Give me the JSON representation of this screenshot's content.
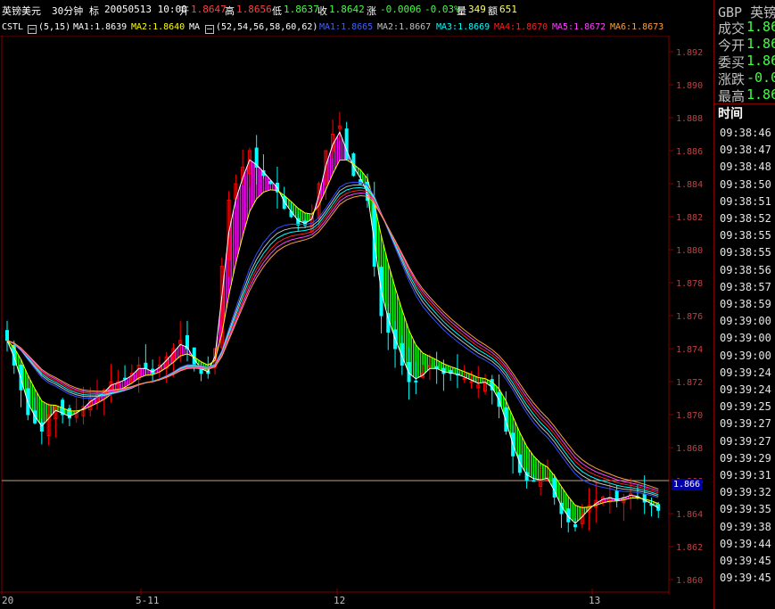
{
  "header": {
    "symbol": "英镑美元",
    "period": "30分钟",
    "marker": "标",
    "datetime": "20050513 10:00",
    "open_label": "开",
    "open": "1.8647",
    "high_label": "高",
    "high": "1.8656",
    "low_label": "低",
    "low": "1.8637",
    "close_label": "收",
    "close": "1.8642",
    "change_label": "涨",
    "change": "-0.0006",
    "change_pct": "-0.03%",
    "volume_label": "量",
    "volume": "349",
    "amount_label": "额",
    "amount": "651"
  },
  "indicators": {
    "cstl": "CSTL",
    "cstl_params": "(5,15)",
    "ma1": "MA1:1.8639",
    "ma2": "MA2:1.8640",
    "ma": "MA",
    "ma_params": "(52,54,56,58,60,62)",
    "m1": "MA1:1.8665",
    "m2": "MA2:1.8667",
    "m3": "MA3:1.8669",
    "m4": "MA4:1.8670",
    "m5": "MA5:1.8672",
    "m6": "MA6:1.8673"
  },
  "axis": {
    "y_ticks": [
      "1.892",
      "1.890",
      "1.888",
      "1.886",
      "1.884",
      "1.882",
      "1.880",
      "1.878",
      "1.876",
      "1.874",
      "1.872",
      "1.870",
      "1.868",
      "1.866",
      "1.864",
      "1.862",
      "1.860"
    ],
    "x_ticks": [
      "20",
      "5-11",
      "12",
      "13"
    ],
    "current_price": "1.866"
  },
  "right_panel": {
    "title": "GBP 英镑",
    "rows": [
      {
        "label": "成交",
        "value": "1.86"
      },
      {
        "label": "今开",
        "value": "1.86"
      },
      {
        "label": "委买",
        "value": "1.86"
      },
      {
        "label": "涨跌",
        "value": "-0.0"
      },
      {
        "label": "最高",
        "value": "1.86"
      }
    ],
    "time_header": "时间",
    "times": [
      "09:38:46",
      "09:38:47",
      "09:38:48",
      "09:38:50",
      "09:38:51",
      "09:38:52",
      "09:38:55",
      "09:38:55",
      "09:38:56",
      "09:38:57",
      "09:38:59",
      "09:39:00",
      "09:39:00",
      "09:39:00",
      "09:39:24",
      "09:39:24",
      "09:39:25",
      "09:39:27",
      "09:39:27",
      "09:39:29",
      "09:39:31",
      "09:39:32",
      "09:39:35",
      "09:39:38",
      "09:39:44",
      "09:39:45",
      "09:39:45"
    ]
  },
  "colors": {
    "up": "#ff0000",
    "down": "#00ffff",
    "fill_up": "#ff00ff",
    "fill_down": "#00ff00",
    "ma_blue": "#3050ff",
    "ma_yellow": "#ffff00",
    "ma_orange": "#ff8000"
  },
  "chart_data": {
    "type": "candlestick",
    "ylim": [
      1.86,
      1.893
    ],
    "x_ticks": [
      "20",
      "5-11",
      "12",
      "13"
    ],
    "current_price": 1.866,
    "approx_close": [
      1.8745,
      1.873,
      1.8715,
      1.87,
      1.8695,
      1.869,
      1.87,
      1.8705,
      1.87,
      1.8698,
      1.8702,
      1.8705,
      1.871,
      1.8712,
      1.8715,
      1.872,
      1.872,
      1.8722,
      1.8725,
      1.873,
      1.8728,
      1.8725,
      1.873,
      1.8735,
      1.874,
      1.8745,
      1.874,
      1.873,
      1.8725,
      1.8725,
      1.874,
      1.879,
      1.883,
      1.884,
      1.885,
      1.886,
      1.885,
      1.8845,
      1.884,
      1.8835,
      1.8825,
      1.882,
      1.8815,
      1.8815,
      1.882,
      1.884,
      1.886,
      1.887,
      1.8875,
      1.8855,
      1.8845,
      1.884,
      1.883,
      1.879,
      1.876,
      1.875,
      1.874,
      1.873,
      1.872,
      1.872,
      1.8725,
      1.873,
      1.8728,
      1.8725,
      1.8725,
      1.8724,
      1.8722,
      1.872,
      1.8718,
      1.872,
      1.8715,
      1.8705,
      1.869,
      1.8675,
      1.8665,
      1.866,
      1.866,
      1.866,
      1.8662,
      1.865,
      1.864,
      1.8635,
      1.8632,
      1.864,
      1.8645,
      1.8648,
      1.865,
      1.865,
      1.8648,
      1.865,
      1.8652,
      1.865,
      1.8647,
      1.8645,
      1.8642
    ]
  }
}
